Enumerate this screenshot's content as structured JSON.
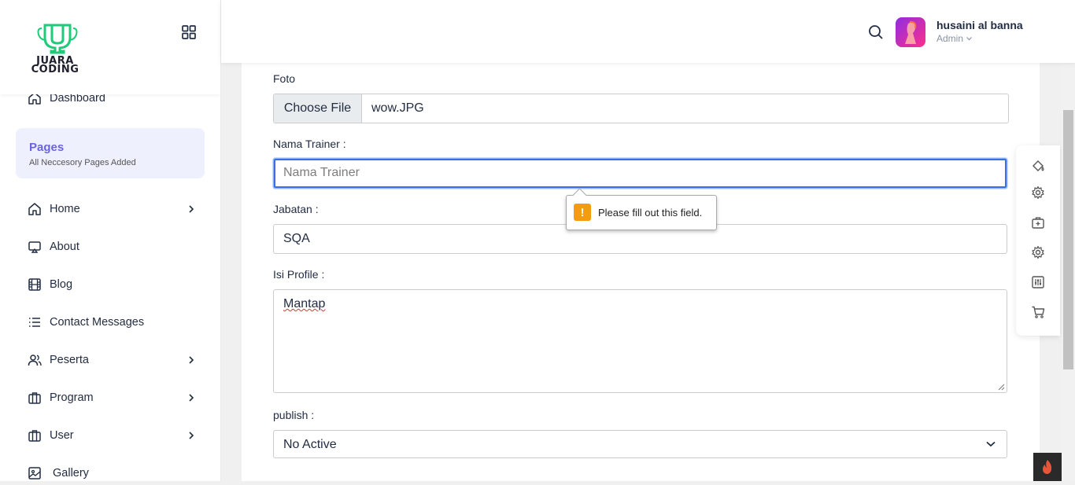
{
  "sidebar": {
    "logo_text_line1": "JUARA",
    "logo_text_line2": "CODING",
    "items": [
      {
        "label": "Dashboard"
      },
      {
        "label": "Home"
      },
      {
        "label": "About"
      },
      {
        "label": "Blog"
      },
      {
        "label": "Contact Messages"
      },
      {
        "label": "Peserta"
      },
      {
        "label": "Program"
      },
      {
        "label": "User"
      },
      {
        "label": "Gallery"
      }
    ],
    "pages_box": {
      "title": "Pages",
      "subtitle": "All Neccesory Pages Added"
    }
  },
  "header": {
    "user_name": "husaini al banna",
    "user_role": "Admin"
  },
  "form": {
    "foto_label": "Foto",
    "file_button": "Choose File",
    "file_name": "wow.JPG",
    "nama_label": "Nama Trainer :",
    "nama_placeholder": "Nama Trainer",
    "jabatan_label": "Jabatan :",
    "jabatan_value": "SQA",
    "profile_label": "Isi Profile :",
    "profile_value": "Mantap",
    "publish_label": "publish :",
    "publish_value": "No Active"
  },
  "validation": {
    "icon": "!",
    "message": "Please fill out this field."
  },
  "colors": {
    "accent": "#6b63e3",
    "logo_green": "#1ecb7a",
    "warning": "#f39c12",
    "focus_border": "#86b7fe"
  },
  "icons": [
    "search-icon",
    "paint-bucket-icon",
    "gear-icon",
    "briefcase-icon",
    "sliders-icon",
    "cart-icon",
    "flame-icon",
    "grid-icon"
  ]
}
